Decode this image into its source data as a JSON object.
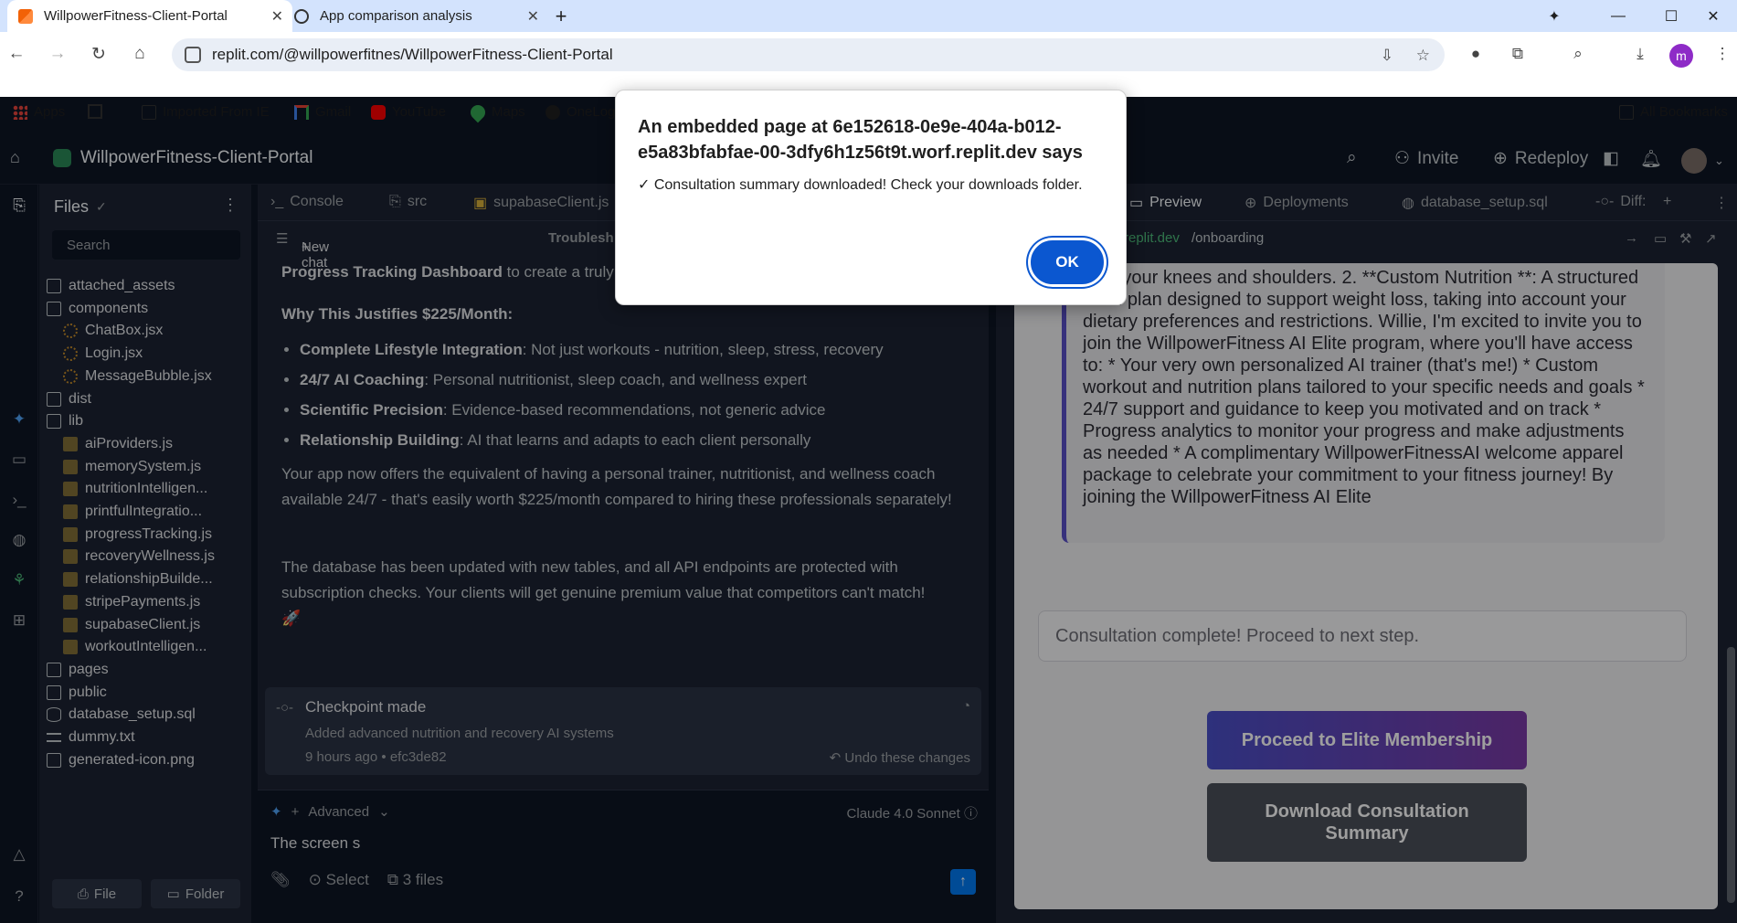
{
  "browser": {
    "tabs": [
      {
        "title": "WillpowerFitness-Client-Portal"
      },
      {
        "title": "App comparison analysis"
      }
    ],
    "url": "replit.com/@willpowerfitnes/WillpowerFitness-Client-Portal",
    "profile_initial": "m",
    "bookmarks": [
      "Apps",
      "Imported From IE",
      "Gmail",
      "YouTube",
      "Maps",
      "OneLog"
    ],
    "all_bookmarks": "All Bookmarks"
  },
  "replit": {
    "project_name": "WillpowerFitness-Client-Portal",
    "invite": "Invite",
    "redeploy": "Redeploy"
  },
  "files": {
    "title": "Files",
    "search_placeholder": "Search",
    "tree": [
      {
        "name": "attached_assets",
        "type": "folder",
        "depth": 0
      },
      {
        "name": "components",
        "type": "folder",
        "depth": 0
      },
      {
        "name": "ChatBox.jsx",
        "type": "jsx",
        "depth": 1
      },
      {
        "name": "Login.jsx",
        "type": "jsx",
        "depth": 1
      },
      {
        "name": "MessageBubble.jsx",
        "type": "jsx",
        "depth": 1
      },
      {
        "name": "dist",
        "type": "folder",
        "depth": 0
      },
      {
        "name": "lib",
        "type": "folder",
        "depth": 0
      },
      {
        "name": "aiProviders.js",
        "type": "js",
        "depth": 1
      },
      {
        "name": "memorySystem.js",
        "type": "js",
        "depth": 1
      },
      {
        "name": "nutritionIntelligen...",
        "type": "js",
        "depth": 1
      },
      {
        "name": "printfulIntegratio...",
        "type": "js",
        "depth": 1
      },
      {
        "name": "progressTracking.js",
        "type": "js",
        "depth": 1
      },
      {
        "name": "recoveryWellness.js",
        "type": "js",
        "depth": 1
      },
      {
        "name": "relationshipBuilde...",
        "type": "js",
        "depth": 1
      },
      {
        "name": "stripePayments.js",
        "type": "js",
        "depth": 1
      },
      {
        "name": "supabaseClient.js",
        "type": "js",
        "depth": 1
      },
      {
        "name": "workoutIntelligen...",
        "type": "js",
        "depth": 1
      },
      {
        "name": "pages",
        "type": "folder",
        "depth": 0
      },
      {
        "name": "public",
        "type": "folder",
        "depth": 0
      },
      {
        "name": "database_setup.sql",
        "type": "db",
        "depth": 0
      },
      {
        "name": "dummy.txt",
        "type": "txt",
        "depth": 0
      },
      {
        "name": "generated-icon.png",
        "type": "img",
        "depth": 0
      }
    ],
    "new_file": "File",
    "new_folder": "Folder"
  },
  "center": {
    "tabs": [
      "Console",
      "src",
      "supabaseClient.js"
    ],
    "new_chat": "New chat",
    "chat_title": "Troublesh",
    "intro_bold": "Progress Tracking Dashboard",
    "intro_rest": "to create a truly",
    "heading": "Why This Justifies $225/Month:",
    "bullets": [
      {
        "bold": "Complete Lifestyle Integration",
        "text": ": Not just workouts - nutrition, sleep, stress, recovery"
      },
      {
        "bold": "24/7 AI Coaching",
        "text": ": Personal nutritionist, sleep coach, and wellness expert"
      },
      {
        "bold": "Scientific Precision",
        "text": ": Evidence-based recommendations, not generic advice"
      },
      {
        "bold": "Relationship Building",
        "text": ": AI that learns and adapts to each client personally"
      }
    ],
    "para1": "Your app now offers the equivalent of having a personal trainer, nutritionist, and wellness coach available 24/7 - that's easily worth $225/month compared to hiring these professionals separately!",
    "para2": "The database has been updated with new tables, and all API endpoints are protected with subscription checks. Your clients will get genuine premium value that competitors can't match!",
    "rocket": "🚀",
    "checkpoint": {
      "title": "Checkpoint made",
      "desc": "Added advanced nutrition and recovery AI systems",
      "time": "9 hours ago",
      "hash": "• efc3de82",
      "undo": "Undo these changes"
    },
    "composer": {
      "advanced": "Advanced",
      "model": "Claude 4.0 Sonnet",
      "text": "The screen s",
      "select": "Select",
      "files": "3 files"
    }
  },
  "right": {
    "tabs": [
      "Preview",
      "Deployments",
      "database_setup.sql",
      "Diff:"
    ],
    "url_host": "replit.dev",
    "url_path": "/onboarding",
    "message": "s on your knees and shoulders. 2. **Custom Nutrition **: A structured meal plan designed to support weight loss, taking into account your dietary preferences and restrictions. Willie, I'm excited to invite you to join the WillpowerFitness AI Elite program, where you'll have access to: * Your very own personalized AI trainer (that's me!) * Custom workout and nutrition plans tailored to your specific needs and goals * 24/7 support and guidance to keep you motivated and on track * Progress analytics to monitor your progress and make adjustments as needed * A complimentary WillpowerFitnessAI welcome apparel package to celebrate your commitment to your fitness journey! By joining the WillpowerFitness AI Elite",
    "status": "Consultation complete! Proceed to next step.",
    "btn_elite": "Proceed to Elite Membership",
    "btn_download": "Download Consultation Summary"
  },
  "alert": {
    "title": "An embedded page at 6e152618-0e9e-404a-b012-e5a83bfabfae-00-3dfy6h1z56t9t.worf.replit.dev says",
    "message": "✓ Consultation summary downloaded! Check your downloads folder.",
    "ok": "OK"
  }
}
